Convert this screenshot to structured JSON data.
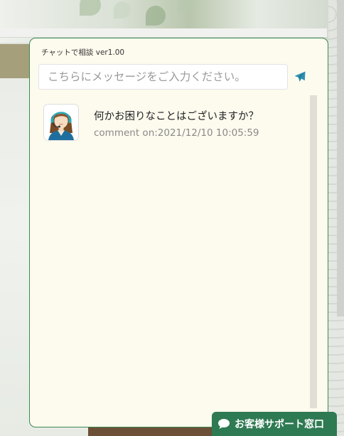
{
  "chat": {
    "title": "チャットで相談 ver1.00",
    "input": {
      "placeholder": "こちらにメッセージをご入力ください。",
      "value": ""
    },
    "send_icon": "paper-plane-icon",
    "messages": [
      {
        "avatar_icon": "operator-avatar-icon",
        "text": "何かお困りなことはございますか？",
        "time": "comment on:2021/12/10 10:05:59"
      }
    ]
  },
  "support_tab": {
    "label": "お客様サポート窓口",
    "icon": "speech-bubble-icon"
  },
  "colors": {
    "panel_bg": "#fdfaee",
    "panel_border": "#3a8a4f",
    "send_icon": "#2f8fb0",
    "support_tab_bg": "#2e7a52"
  }
}
